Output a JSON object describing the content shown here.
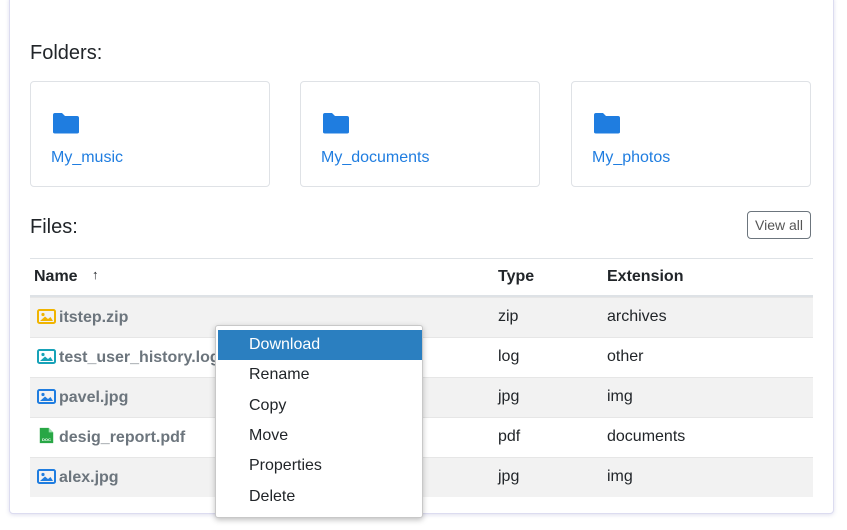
{
  "folders_title": "Folders:",
  "folders": [
    {
      "name": "My_music",
      "icon": "folder-icon"
    },
    {
      "name": "My_documents",
      "icon": "folder-icon"
    },
    {
      "name": "My_photos",
      "icon": "folder-icon"
    }
  ],
  "files_title": "Files:",
  "view_all_label": "View all",
  "table": {
    "headers": {
      "name": "Name",
      "sort_indicator": "↑",
      "type": "Type",
      "extension": "Extension"
    },
    "rows": [
      {
        "name": "itstep.zip",
        "type": "zip",
        "extension": "archives",
        "icon": "image-file-icon",
        "icon_color": "#f0b400"
      },
      {
        "name": "test_user_history.log",
        "type": "log",
        "extension": "other",
        "icon": "image-file-icon",
        "icon_color": "#17a2b8"
      },
      {
        "name": "pavel.jpg",
        "type": "jpg",
        "extension": "img",
        "icon": "image-file-icon",
        "icon_color": "#1f7de0"
      },
      {
        "name": "desig_report.pdf",
        "type": "pdf",
        "extension": "documents",
        "icon": "doc-file-icon",
        "icon_color": "#28a745"
      },
      {
        "name": "alex.jpg",
        "type": "jpg",
        "extension": "img",
        "icon": "image-file-icon",
        "icon_color": "#1f7de0"
      }
    ]
  },
  "context_menu": {
    "items": [
      "Download",
      "Rename",
      "Copy",
      "Move",
      "Properties",
      "Delete"
    ],
    "highlighted": "Download"
  },
  "colors": {
    "accent": "#1f7de0",
    "menu_highlight": "#2b7fc0",
    "row_alt": "#f2f2f2"
  }
}
